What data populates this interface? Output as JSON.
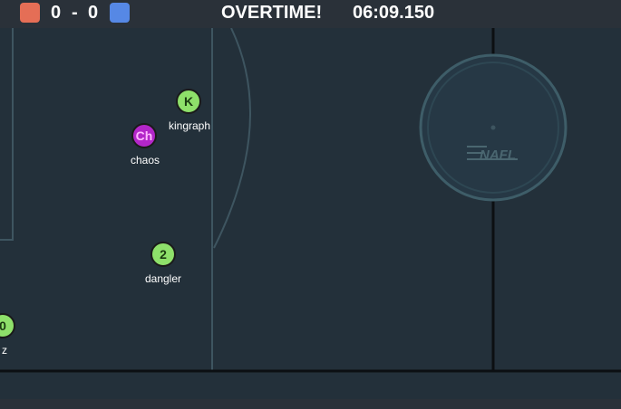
{
  "scoreboard": {
    "red_score": "0",
    "separator": "-",
    "blue_score": "0",
    "status": "OVERTIME!",
    "time": "06:09.150",
    "red_color": "#e56e56",
    "blue_color": "#5688e5"
  },
  "field": {
    "logo_text": "NAFL",
    "background": "#23303a",
    "line_color": "#3e5560"
  },
  "players": [
    {
      "id": "kingraph",
      "initials": "K",
      "name": "kingraph",
      "color": "#8ee06a",
      "text_color": "#1a3a10"
    },
    {
      "id": "chaos",
      "initials": "Ch",
      "name": "chaos",
      "color": "#b326c9",
      "text_color": "#ffb8ff"
    },
    {
      "id": "dangler",
      "initials": "2",
      "name": "dangler",
      "color": "#8ee06a",
      "text_color": "#1a3a10"
    },
    {
      "id": "edge-player",
      "initials": "0",
      "name": "z",
      "color": "#8ee06a",
      "text_color": "#1a3a10"
    }
  ]
}
